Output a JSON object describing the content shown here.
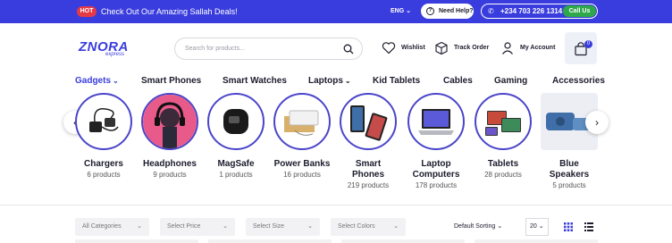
{
  "topbar": {
    "hot_badge": "HOT",
    "promo_text": "Check Out Our Amazing Sallah Deals!",
    "language": "ENG",
    "help_label": "Need Help?",
    "phone": "+234 703 226 1314",
    "call_label": "Call Us",
    "accent_color": "#3a3ddd"
  },
  "header": {
    "logo_text": "ZNORA",
    "logo_sub": "express",
    "search_placeholder": "Search for products...",
    "wishlist_label": "Wishlist",
    "track_order_label": "Track Order",
    "account_label": "My Account",
    "cart_count": "0"
  },
  "nav": {
    "items": [
      {
        "label": "Gadgets",
        "has_dropdown": true,
        "active": true
      },
      {
        "label": "Smart Phones"
      },
      {
        "label": "Smart Watches"
      },
      {
        "label": "Laptops",
        "has_dropdown": true
      },
      {
        "label": "Kid Tablets"
      },
      {
        "label": "Cables"
      },
      {
        "label": "Gaming"
      },
      {
        "label": "Accessories"
      }
    ]
  },
  "categories": [
    {
      "name": "Chargers",
      "count": "6 products"
    },
    {
      "name": "Headphones",
      "count": "9 products"
    },
    {
      "name": "MagSafe",
      "count": "1 products"
    },
    {
      "name": "Power Banks",
      "count": "16 products"
    },
    {
      "name": "Smart Phones",
      "name_line1": "Smart",
      "name_line2": "Phones",
      "count": "219 products"
    },
    {
      "name": "Laptop Computers",
      "name_line1": "Laptop",
      "name_line2": "Computers",
      "count": "178 products"
    },
    {
      "name": "Tablets",
      "count": "28 products"
    },
    {
      "name": "Blue Speakers",
      "name_line1": "Blue",
      "name_line2": "Speakers",
      "count": "5 products"
    }
  ],
  "filters": {
    "category": "All Categories",
    "price": "Select Price",
    "size": "Select Size",
    "colors": "Select Colors",
    "sorting": "Default Sorting",
    "per_page": "20"
  }
}
